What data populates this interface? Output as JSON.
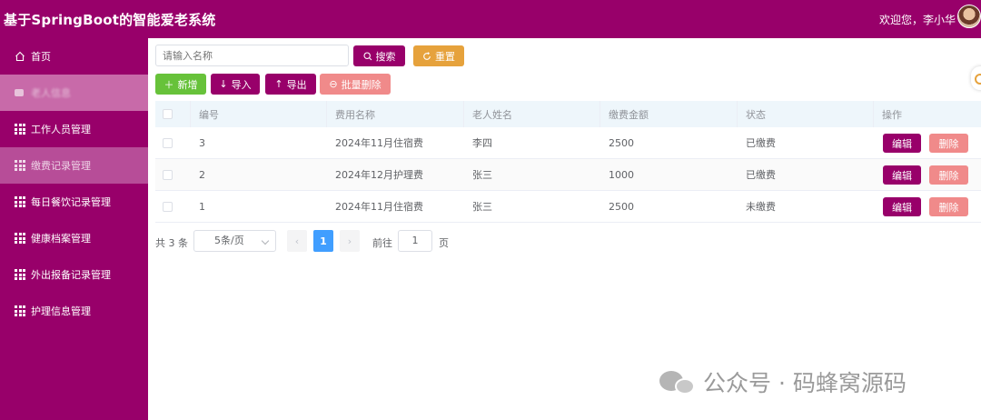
{
  "header": {
    "title": "基于SpringBoot的智能爱老系统",
    "welcome": "欢迎您，李小华"
  },
  "sidebar": {
    "items": [
      {
        "label": "首页",
        "icon": "home-icon"
      },
      {
        "label": "老人信息",
        "icon": "grid-icon"
      },
      {
        "label": "工作人员管理",
        "icon": "grid-icon"
      },
      {
        "label": "缴费记录管理",
        "icon": "grid-icon"
      },
      {
        "label": "每日餐饮记录管理",
        "icon": "grid-icon"
      },
      {
        "label": "健康档案管理",
        "icon": "grid-icon"
      },
      {
        "label": "外出报备记录管理",
        "icon": "grid-icon"
      },
      {
        "label": "护理信息管理",
        "icon": "grid-icon"
      }
    ]
  },
  "search": {
    "placeholder": "请输入名称",
    "search_label": "搜索",
    "reset_label": "重置"
  },
  "toolbar": {
    "add_label": "新增",
    "import_label": "导入",
    "export_label": "导出",
    "batch_delete_label": "批量删除"
  },
  "table": {
    "columns": [
      "编号",
      "费用名称",
      "老人姓名",
      "缴费金额",
      "状态",
      "操作"
    ],
    "rows": [
      {
        "id": "3",
        "fee_name": "2024年11月住宿费",
        "elder_name": "李四",
        "amount": "2500",
        "status": "已缴费"
      },
      {
        "id": "2",
        "fee_name": "2024年12月护理费",
        "elder_name": "张三",
        "amount": "1000",
        "status": "已缴费"
      },
      {
        "id": "1",
        "fee_name": "2024年11月住宿费",
        "elder_name": "张三",
        "amount": "2500",
        "status": "未缴费"
      }
    ],
    "edit_label": "编辑",
    "delete_label": "删除"
  },
  "pagination": {
    "total": "共 3 条",
    "page_size": "5条/页",
    "current_page": "1",
    "goto_label": "前往",
    "goto_value": "1",
    "goto_unit": "页"
  },
  "watermark": {
    "text": "公众号 · 码蜂窝源码"
  },
  "colors": {
    "brand": "#98006a",
    "warning": "#e6a23c",
    "success": "#67c23a",
    "danger_light": "#f08a8a",
    "page_active": "#409eff"
  }
}
